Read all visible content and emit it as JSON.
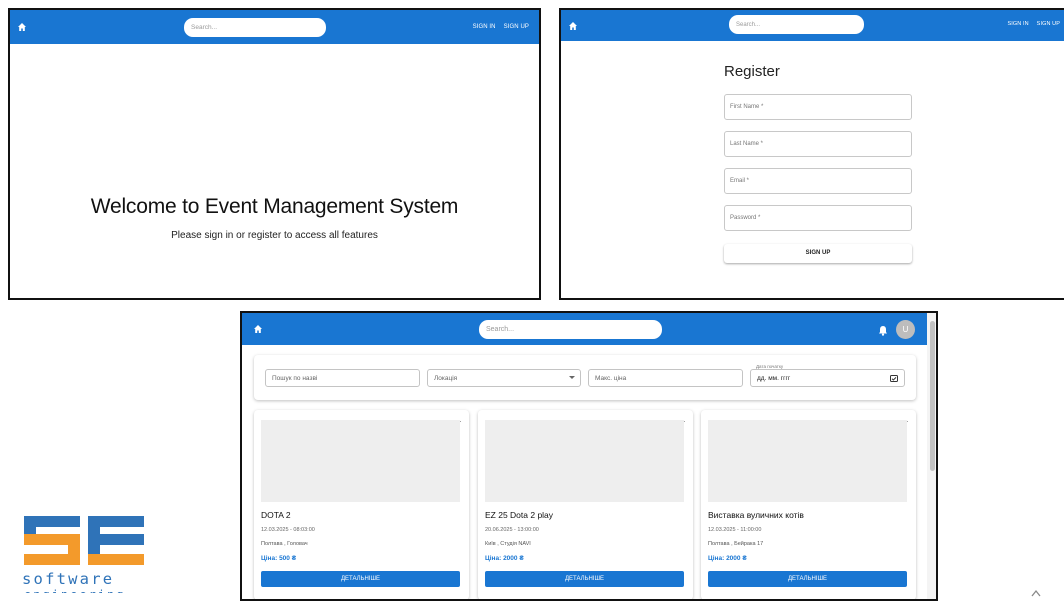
{
  "screen1": {
    "search_placeholder": "Search...",
    "nav": [
      "SIGN IN",
      "SIGN UP"
    ],
    "welcome_title": "Welcome to Event Management System",
    "welcome_subtitle": "Please sign in or register to access all features"
  },
  "screen2": {
    "search_placeholder": "Search...",
    "nav": [
      "SIGN IN",
      "SIGN UP"
    ],
    "title": "Register",
    "fields": [
      "First Name *",
      "Last Name *",
      "Email *",
      "Password *"
    ],
    "submit_label": "SIGN UP"
  },
  "screen3": {
    "search_placeholder": "Search...",
    "avatar_letter": "U",
    "filters": {
      "name_placeholder": "Пошук по назві",
      "location_label": "Локація",
      "max_price_placeholder": "Макс. ціна",
      "date_label": "Дата початку",
      "date_value": "дд. мм. гггг"
    },
    "events": [
      {
        "title": "DOTA 2",
        "datetime": "12.03.2025 - 08:03:00",
        "location": "Полтава , Головач",
        "price": "Ціна: 500 ₴",
        "button": "ДЕТАЛЬНІШЕ"
      },
      {
        "title": "EZ 25 Dota 2 play",
        "datetime": "20.06.2025 - 13:00:00",
        "location": "Київ , Студія NAVI",
        "price": "Ціна: 2000 ₴",
        "button": "ДЕТАЛЬНІШЕ"
      },
      {
        "title": "Виставка вуличних котів",
        "datetime": "12.03.2025 - 11:00:00",
        "location": "Полтава , Бейрака 17",
        "price": "Ціна: 2000 ₴",
        "button": "ДЕТАЛЬНІШЕ"
      }
    ]
  },
  "logo": {
    "word1": "software",
    "word2": "engineering",
    "colors": {
      "orange": "#f39a2b",
      "blue": "#2f73b8"
    }
  },
  "colors": {
    "appbar": "#1976d2",
    "price": "#1976d2"
  }
}
